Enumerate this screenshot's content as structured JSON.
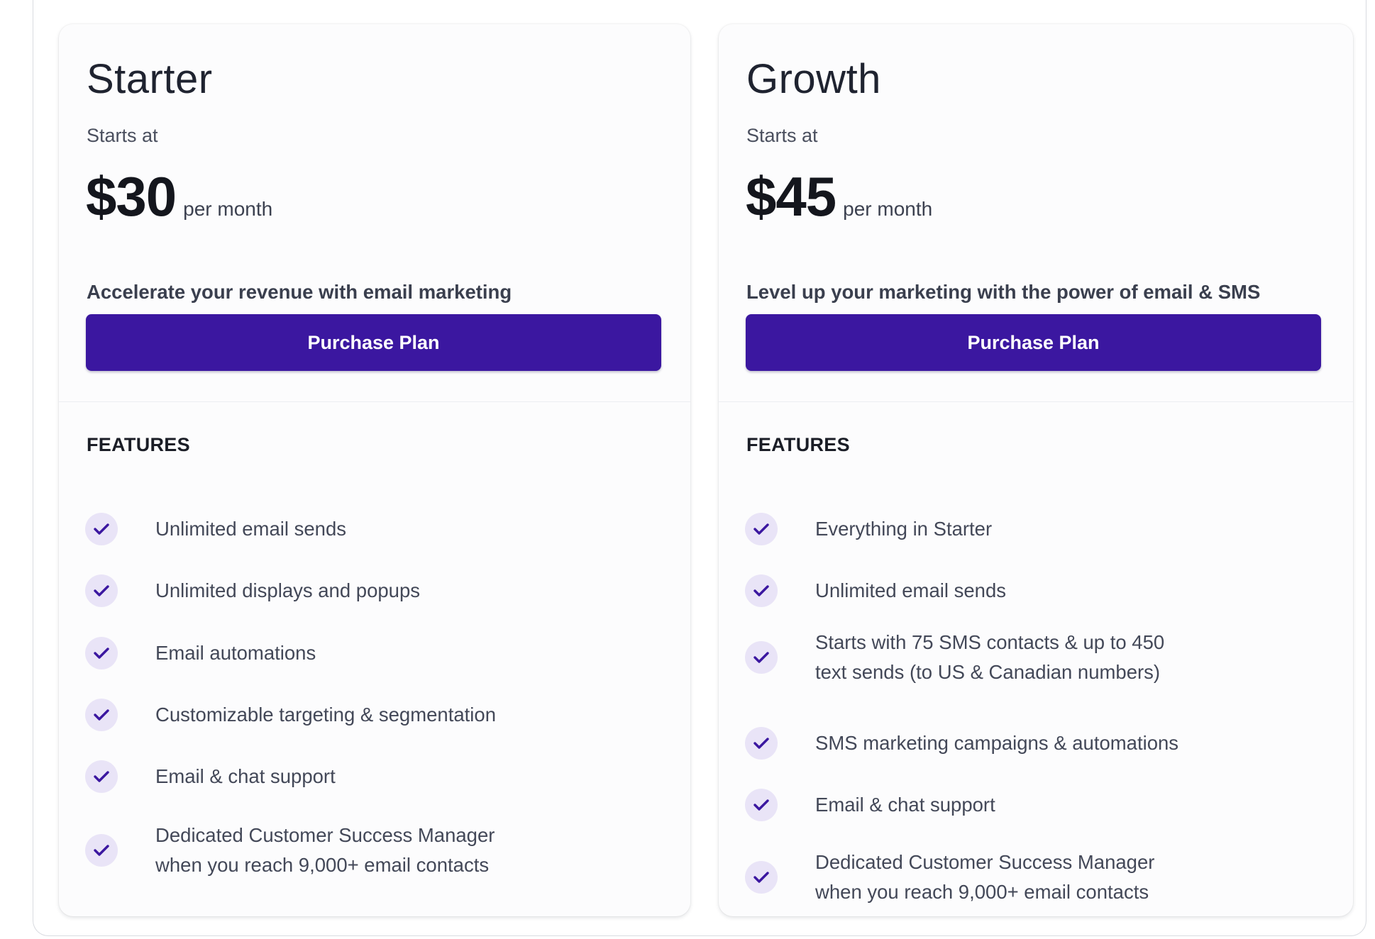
{
  "plans": [
    {
      "name": "Starter",
      "starts_at": "Starts at",
      "price": "$30",
      "period": "per month",
      "tagline": "Accelerate your revenue with email marketing",
      "button_label": "Purchase Plan",
      "features_title": "FEATURES",
      "features": [
        "Unlimited email sends",
        "Unlimited displays and popups",
        "Email automations",
        "Customizable targeting & segmentation",
        "Email & chat support",
        "Dedicated Customer Success Manager\nwhen you reach 9,000+ email contacts"
      ]
    },
    {
      "name": "Growth",
      "starts_at": "Starts at",
      "price": "$45",
      "period": "per month",
      "tagline": "Level up your marketing with the power of email & SMS",
      "button_label": "Purchase Plan",
      "features_title": "FEATURES",
      "features": [
        "Everything in Starter",
        "Unlimited email sends",
        "Starts with 75 SMS contacts & up to 450\ntext sends (to US & Canadian numbers)",
        "SMS marketing campaigns & automations",
        "Email & chat support",
        "Dedicated Customer Success Manager\nwhen you reach 9,000+ email contacts"
      ]
    }
  ],
  "colors": {
    "accent": "#3b17a0",
    "check_bg": "#e9e4f7",
    "check_mark": "#3b17a0"
  },
  "icons": {
    "feature_check": "check-icon"
  }
}
